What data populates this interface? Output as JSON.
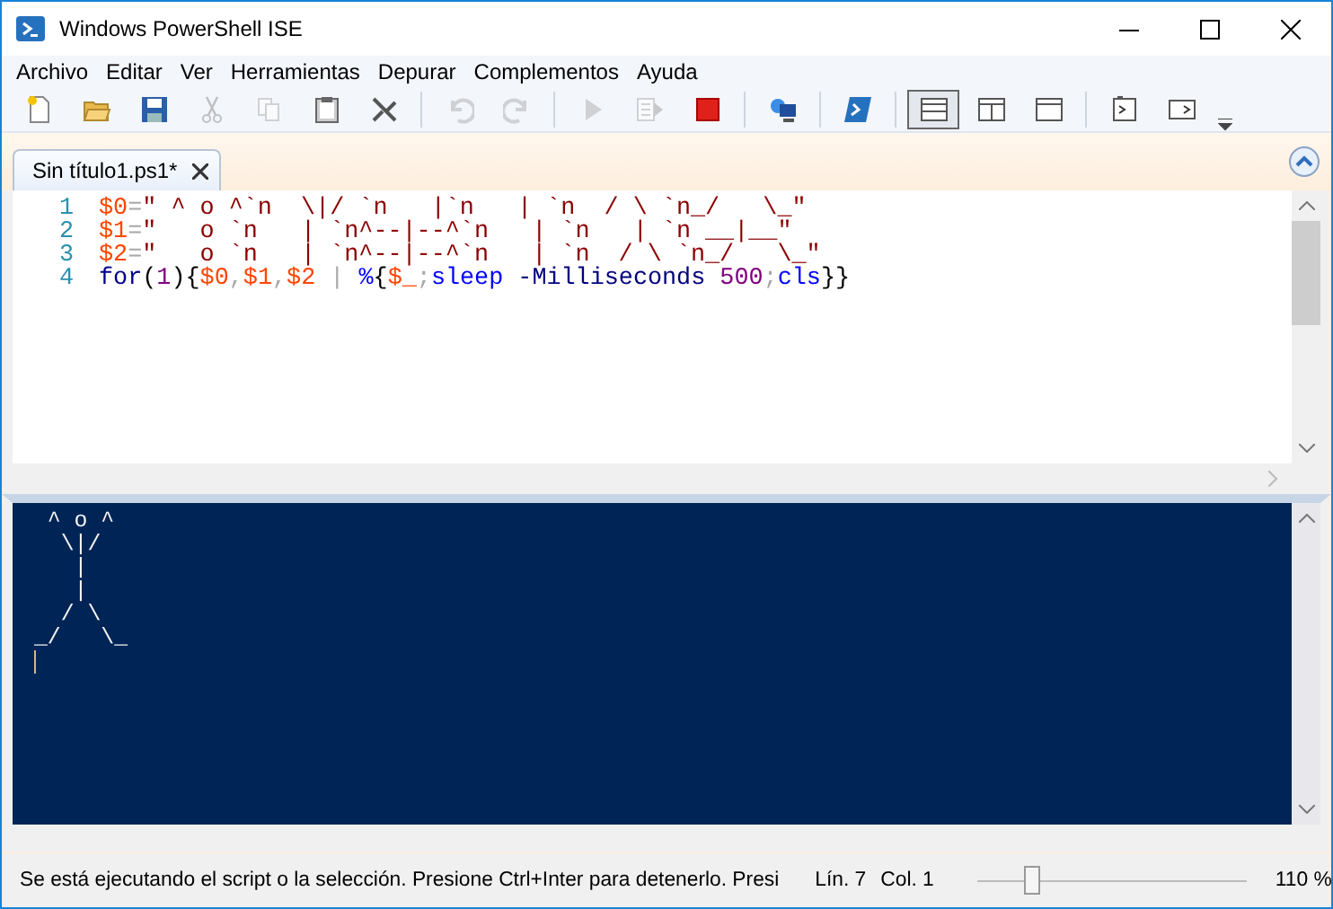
{
  "window": {
    "title": "Windows PowerShell ISE"
  },
  "menu": [
    "Archivo",
    "Editar",
    "Ver",
    "Herramientas",
    "Depurar",
    "Complementos",
    "Ayuda"
  ],
  "toolbar_groups": [
    [
      {
        "kind": "new",
        "disabled": false
      },
      {
        "kind": "open",
        "disabled": false
      },
      {
        "kind": "save",
        "disabled": false
      },
      {
        "kind": "cut",
        "disabled": true
      },
      {
        "kind": "copy",
        "disabled": true
      },
      {
        "kind": "paste",
        "disabled": false
      },
      {
        "kind": "clear",
        "disabled": false
      }
    ],
    [
      {
        "kind": "undo",
        "disabled": true
      },
      {
        "kind": "redo",
        "disabled": true
      }
    ],
    [
      {
        "kind": "run",
        "disabled": true
      },
      {
        "kind": "run-selection",
        "disabled": true
      },
      {
        "kind": "stop",
        "disabled": false
      }
    ],
    [
      {
        "kind": "remote",
        "disabled": false
      }
    ],
    [
      {
        "kind": "powershell",
        "disabled": false
      }
    ],
    [
      {
        "kind": "layout-top",
        "selected": true
      },
      {
        "kind": "layout-right",
        "selected": false
      },
      {
        "kind": "layout-max",
        "selected": false
      }
    ],
    [
      {
        "kind": "script-pane",
        "disabled": false
      },
      {
        "kind": "command-pane",
        "disabled": false
      }
    ]
  ],
  "tabs": [
    {
      "label": "Sin título1.ps1*",
      "selected": true
    }
  ],
  "editor": {
    "lines": [
      {
        "number": "1",
        "tokens": [
          {
            "kind": "variable",
            "text": "$0"
          },
          {
            "kind": "operator",
            "text": "="
          },
          {
            "kind": "string",
            "text": "\" ^ o ^`n  \\|/ `n   |`n   | `n  / \\ `n_/   \\_\""
          }
        ]
      },
      {
        "number": "2",
        "tokens": [
          {
            "kind": "variable",
            "text": "$1"
          },
          {
            "kind": "operator",
            "text": "="
          },
          {
            "kind": "string",
            "text": "\"   o `n   | `n^--|--^`n   | `n   | `n __|__\""
          }
        ]
      },
      {
        "number": "3",
        "tokens": [
          {
            "kind": "variable",
            "text": "$2"
          },
          {
            "kind": "operator",
            "text": "="
          },
          {
            "kind": "string",
            "text": "\"   o `n   | `n^--|--^`n   | `n  / \\ `n_/   \\_\""
          }
        ]
      },
      {
        "number": "4",
        "tokens": [
          {
            "kind": "keyword",
            "text": "for"
          },
          {
            "kind": "group",
            "text": "("
          },
          {
            "kind": "number",
            "text": "1"
          },
          {
            "kind": "group",
            "text": "){"
          },
          {
            "kind": "variable",
            "text": "$0"
          },
          {
            "kind": "operator",
            "text": ","
          },
          {
            "kind": "variable",
            "text": "$1"
          },
          {
            "kind": "operator",
            "text": ","
          },
          {
            "kind": "variable",
            "text": "$2"
          },
          {
            "kind": "operator",
            "text": " | "
          },
          {
            "kind": "command",
            "text": "%"
          },
          {
            "kind": "group",
            "text": "{"
          },
          {
            "kind": "variable",
            "text": "$_"
          },
          {
            "kind": "operator",
            "text": ";"
          },
          {
            "kind": "command",
            "text": "sleep"
          },
          {
            "kind": "parameter",
            "text": " -Milliseconds "
          },
          {
            "kind": "number",
            "text": "500"
          },
          {
            "kind": "operator",
            "text": ";"
          },
          {
            "kind": "command",
            "text": "cls"
          },
          {
            "kind": "group",
            "text": "}}"
          }
        ]
      }
    ]
  },
  "console": {
    "lines": [
      " ^ o ^",
      "  \\|/",
      "   |",
      "   |",
      "  / \\",
      "_/   \\_"
    ]
  },
  "status_bar": {
    "message": "Se está ejecutando el script o la selección. Presione Ctrl+Inter para detenerlo. Presi",
    "line": "Lín. 7",
    "column": "Col. 1",
    "zoom": {
      "level": 0.2,
      "reading": "110 %"
    }
  }
}
